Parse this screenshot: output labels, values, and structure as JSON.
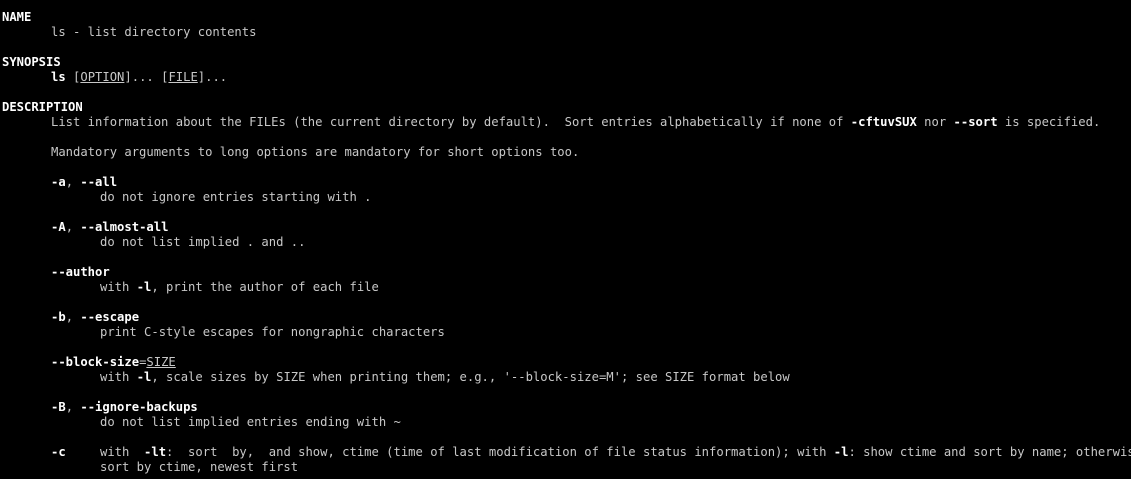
{
  "name_section": {
    "heading": "NAME",
    "text": "ls - list directory contents"
  },
  "synopsis_section": {
    "heading": "SYNOPSIS",
    "cmd": "ls",
    "open1": " [",
    "option": "OPTION",
    "mid": "]... [",
    "file": "FILE",
    "close": "]..."
  },
  "description_section": {
    "heading": "DESCRIPTION",
    "intro_pre": "List information about the FILEs (the current directory by default).  Sort entries alphabetically if none of ",
    "intro_flag1": "-cftuvSUX",
    "intro_mid": " nor ",
    "intro_flag2": "--sort",
    "intro_post": " is specified.",
    "mandatory": "Mandatory arguments to long options are mandatory for short options too."
  },
  "options": {
    "all": {
      "short": "-a",
      "sep": ", ",
      "long": "--all",
      "desc": "do not ignore entries starting with ."
    },
    "almost_all": {
      "short": "-A",
      "sep": ", ",
      "long": "--almost-all",
      "desc": "do not list implied . and .."
    },
    "author": {
      "long": "--author",
      "desc_pre": "with ",
      "desc_flag": "-l",
      "desc_post": ", print the author of each file"
    },
    "escape": {
      "short": "-b",
      "sep": ", ",
      "long": "--escape",
      "desc": "print C-style escapes for nongraphic characters"
    },
    "block_size": {
      "long": "--block-size",
      "eq": "=",
      "arg": "SIZE",
      "desc_pre": "with ",
      "desc_flag": "-l",
      "desc_post": ", scale sizes by SIZE when printing them; e.g., '--block-size=M'; see SIZE format below"
    },
    "ignore_backups": {
      "short": "-B",
      "sep": ", ",
      "long": "--ignore-backups",
      "desc": "do not list implied entries ending with ~"
    },
    "ctime": {
      "short": "-c",
      "desc_a": "with  ",
      "desc_flag1": "-lt",
      "desc_b": ":  sort  by,  and show, ctime (time of last modification of file status information); with ",
      "desc_flag2": "-l",
      "desc_c": ": show ctime and sort by name; otherwise:",
      "desc_line2": "sort by ctime, newest first"
    }
  },
  "colors": {
    "background": "#000000",
    "text": "#c8c8c8",
    "bold": "#ffffff"
  }
}
